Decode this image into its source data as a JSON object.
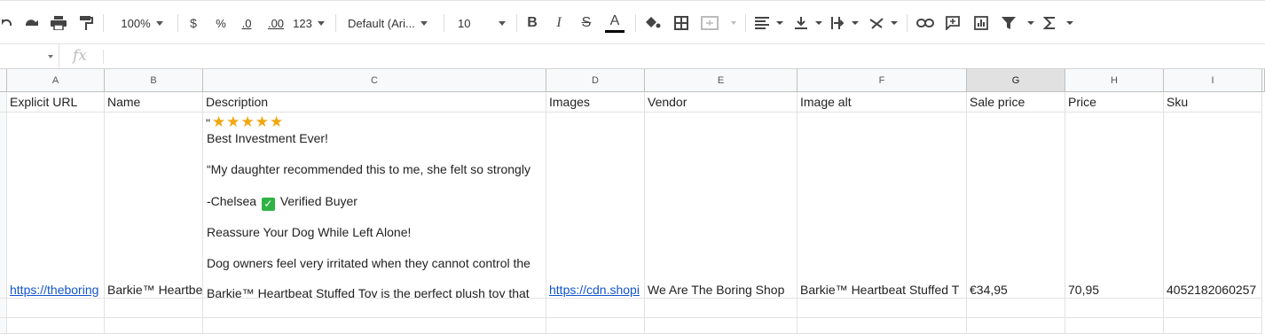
{
  "toolbar": {
    "zoom": "100%",
    "currency": "$",
    "percent": "%",
    "dec_decrease": ".0",
    "dec_increase": ".00",
    "number_format": "123",
    "font": "Default (Ari...",
    "font_size": "10",
    "bold": "B",
    "italic": "I",
    "strike": "S",
    "text_color": "A"
  },
  "formula_bar": {
    "fx": "fx"
  },
  "columns": [
    "A",
    "B",
    "C",
    "D",
    "E",
    "F",
    "G",
    "H",
    "I"
  ],
  "selected_column": "G",
  "headers": [
    "Explicit URL",
    "Name",
    "Description",
    "Images",
    "Vendor",
    "Image alt",
    "Sale price",
    "Price",
    "Sku"
  ],
  "row": {
    "explicit_url": "https://theboring",
    "name": "Barkie™ Heartbe",
    "images": "https://cdn.shopi",
    "vendor": "We Are The Boring Shop",
    "image_alt": "Barkie™ Heartbeat Stuffed T",
    "sale_price": "€34,95",
    "price": "70,95",
    "sku": "4052182060257"
  },
  "description": {
    "quote_open": "\"",
    "stars": "★★★★★",
    "line1": "Best Investment Ever!",
    "line2": "“My daughter recommended this to me, she felt so strongly",
    "line3a": "-Chelsea",
    "line3b": "Verified Buyer",
    "line4": "Reassure Your Dog While Left Alone!",
    "line5": "Dog owners feel very irritated when they cannot control the",
    "line6": "Barkie™ Heartbeat Stuffed Toy is the perfect plush toy that"
  },
  "colors": {
    "link": "#1155cc",
    "star": "#f1a710",
    "check": "#2fb344",
    "selected_header": "#e1e1e1"
  }
}
